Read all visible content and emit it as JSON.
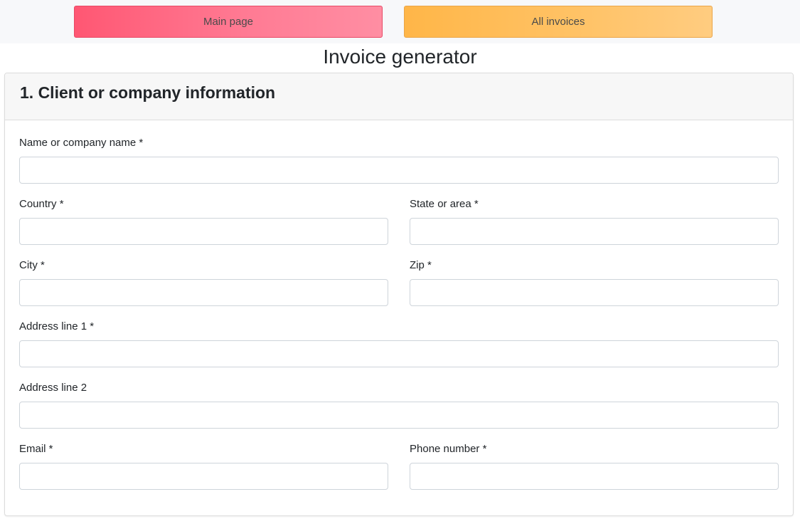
{
  "nav": {
    "main_page_label": "Main page",
    "all_invoices_label": "All invoices"
  },
  "page": {
    "title": "Invoice generator"
  },
  "section": {
    "title": "1. Client or company information"
  },
  "form": {
    "name": {
      "label": "Name or company name *",
      "value": ""
    },
    "country": {
      "label": "Country *",
      "value": ""
    },
    "state": {
      "label": "State or area *",
      "value": ""
    },
    "city": {
      "label": "City *",
      "value": ""
    },
    "zip": {
      "label": "Zip *",
      "value": ""
    },
    "address1": {
      "label": "Address line 1 *",
      "value": ""
    },
    "address2": {
      "label": "Address line 2",
      "value": ""
    },
    "email": {
      "label": "Email *",
      "value": ""
    },
    "phone": {
      "label": "Phone number *",
      "value": ""
    }
  },
  "colors": {
    "main_page_button": "#ff6b85",
    "all_invoices_button": "#ffbf5e",
    "topbar_bg": "#f7f8fa",
    "card_header_bg": "#f7f7f7"
  }
}
